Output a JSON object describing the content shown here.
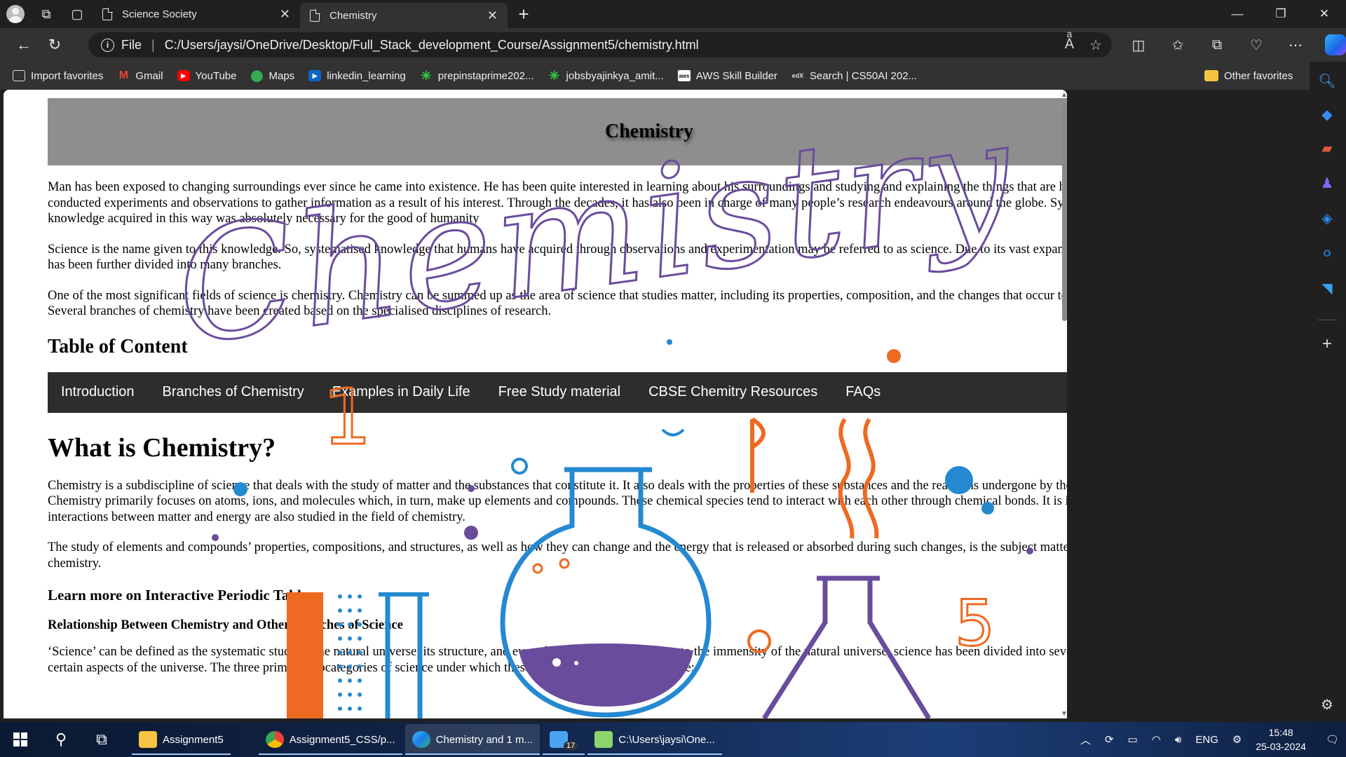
{
  "browser": {
    "tabs": [
      {
        "title": "Science Society",
        "active": false
      },
      {
        "title": "Chemistry",
        "active": true
      }
    ],
    "address": {
      "scheme_label": "File",
      "url": "C:/Users/jaysi/OneDrive/Desktop/Full_Stack_development_Course/Assignment5/chemistry.html"
    },
    "favorites": [
      {
        "label": "Import favorites",
        "icon": "import-icon"
      },
      {
        "label": "Gmail",
        "icon": "gmail-icon"
      },
      {
        "label": "YouTube",
        "icon": "youtube-icon"
      },
      {
        "label": "Maps",
        "icon": "maps-icon"
      },
      {
        "label": "linkedin_learning",
        "icon": "linkedin-icon"
      },
      {
        "label": "prepinstaprime202...",
        "icon": "prepinsta-icon"
      },
      {
        "label": "jobsbyajinkya_amit...",
        "icon": "prepinsta-icon"
      },
      {
        "label": "AWS Skill Builder",
        "icon": "aws-icon"
      },
      {
        "label": "Search | CS50AI 202...",
        "icon": "edx-icon"
      }
    ],
    "other_favorites": "Other favorites"
  },
  "page": {
    "header_title": "Chemistry",
    "intro_paragraphs": [
      "Man has been exposed to changing surroundings ever since he came into existence. He has been quite interested in learning about his surroundings and studying and explaining the things that are happening around him. He has conducted experiments and observations to gather information as a result of his interest. Through the decades, it has also been in charge of many people’s research endeavours around the globe. Systematizing and organising the knowledge acquired in this way was absolutely necessary for the good of humanity",
      "Science is the name given to this knowledge. So, systematised knowledge that humans have acquired through observations and experimentation may be referred to as science. Due to its vast expansion and variety of subjects, science has been further divided into many branches.",
      "One of the most significant fields of science is chemistry. Chemistry can be summed up as the area of science that studies matter, including its properties, composition, and the changes that occur to it as a result of various activities. Several branches of chemistry have been created based on the specialised disciplines of research."
    ],
    "toc_title": "Table of Content",
    "toc_links": [
      "Introduction",
      "Branches of Chemistry",
      "Examples in Daily Life",
      "Free Study material",
      "CBSE Chemitry Resources",
      "FAQs"
    ],
    "what_title": "What is Chemistry?",
    "what_paragraphs": [
      "Chemistry is a subdiscipline of science that deals with the study of matter and the substances that constitute it. It also deals with the properties of these substances and the reactions undergone by them to form new substances. Chemistry primarily focuses on atoms, ions, and molecules which, in turn, make up elements and compounds. These chemical species tend to interact with each other through chemical bonds. It is important to note that the interactions between matter and energy are also studied in the field of chemistry.",
      "The study of elements and compounds’ properties, compositions, and structures, as well as how they can change and the energy that is released or absorbed during such changes, is the subject matter of the science known as chemistry."
    ],
    "learn_more": "Learn more on Interactive Periodic Table",
    "relationship_title": "Relationship Between Chemistry and Other Branches of Science",
    "science_paragraph": "‘Science’ can be defined as the systematic study of the natural universe, its structure, and everything it encompasses. Due to the immensity of the natural universe, science has been divided into several disciplines that deal with certain aspects of the universe. The three primary subcategories of science under which these disciplines can be grouped are:",
    "artwork": {
      "script_word": "Chemistry",
      "numbers": [
        "1",
        "5"
      ],
      "colors": {
        "purple": "#6a4c9c",
        "orange": "#ee6a23",
        "blue": "#2489d1"
      }
    }
  },
  "taskbar": {
    "apps": [
      {
        "label": "Assignment5",
        "icon": "folder-icon"
      },
      {
        "label": "Assignment5_CSS/p...",
        "icon": "chrome-icon"
      },
      {
        "label": "Chemistry and 1 m...",
        "icon": "edge-icon"
      },
      {
        "label": "",
        "icon": "mail-icon",
        "badge": "17"
      },
      {
        "label": "C:\\Users\\jaysi\\One...",
        "icon": "notepad-icon"
      }
    ],
    "language": "ENG",
    "time": "15:48",
    "date": "25-03-2024"
  }
}
